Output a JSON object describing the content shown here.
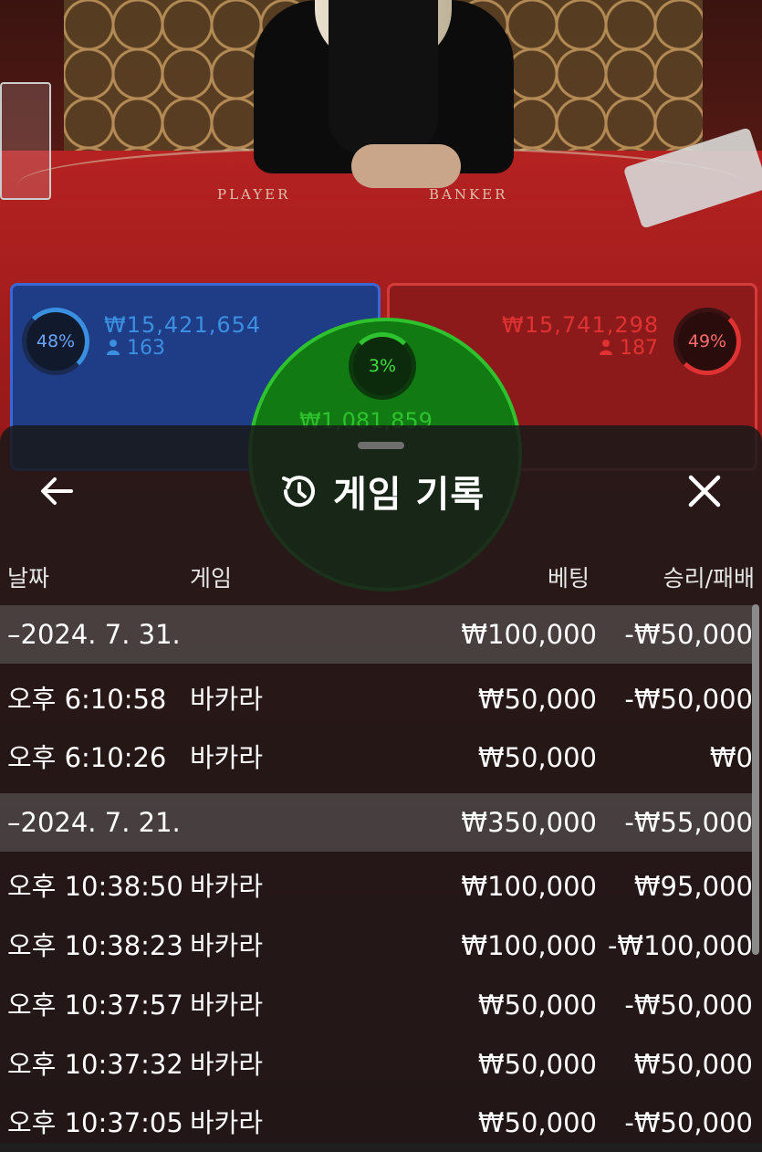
{
  "table": {
    "player_label": "PLAYER",
    "banker_label": "BANKER",
    "player": {
      "percent": "48%",
      "amount": "₩15,421,654",
      "players": "163"
    },
    "banker": {
      "percent": "49%",
      "amount": "₩15,741,298",
      "players": "187"
    },
    "tie": {
      "percent": "3%",
      "amount": "₩1,081,859"
    }
  },
  "sheet": {
    "title": "게임 기록",
    "columns": {
      "date": "날짜",
      "game": "게임",
      "bet": "베팅",
      "result": "승리/패배"
    },
    "rows": [
      {
        "type": "group",
        "date": "–2024. 7. 31.",
        "game": "",
        "bet": "₩100,000",
        "result": "-₩50,000"
      },
      {
        "type": "entry",
        "date": "오후 6:10:58",
        "game": "바카라",
        "bet": "₩50,000",
        "result": "-₩50,000"
      },
      {
        "type": "entry",
        "date": "오후 6:10:26",
        "game": "바카라",
        "bet": "₩50,000",
        "result": "₩0"
      },
      {
        "type": "group",
        "date": "–2024. 7. 21.",
        "game": "",
        "bet": "₩350,000",
        "result": "-₩55,000"
      },
      {
        "type": "entry",
        "date": "오후 10:38:50",
        "game": "바카라",
        "bet": "₩100,000",
        "result": "₩95,000"
      },
      {
        "type": "entry",
        "date": "오후 10:38:23",
        "game": "바카라",
        "bet": "₩100,000",
        "result": "-₩100,000"
      },
      {
        "type": "entry",
        "date": "오후 10:37:57",
        "game": "바카라",
        "bet": "₩50,000",
        "result": "-₩50,000"
      },
      {
        "type": "entry",
        "date": "오후 10:37:32",
        "game": "바카라",
        "bet": "₩50,000",
        "result": "₩50,000"
      },
      {
        "type": "entry",
        "date": "오후 10:37:05",
        "game": "바카라",
        "bet": "₩50,000",
        "result": "-₩50,000"
      }
    ]
  },
  "icons": {
    "back": "arrow-left-icon",
    "history": "history-clock-icon",
    "close": "close-icon",
    "person": "person-icon"
  },
  "colors": {
    "player": "#3b8fe0",
    "banker": "#e03232",
    "tie": "#2ec22e",
    "sheet_bg": "#181818"
  }
}
